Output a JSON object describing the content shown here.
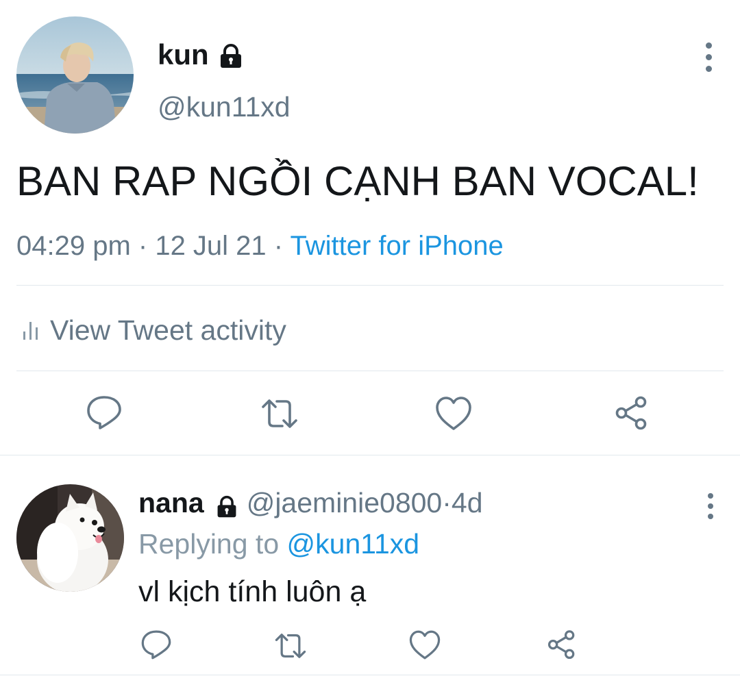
{
  "tweet": {
    "author_name": "kun",
    "author_handle": "@kun11xd",
    "protected": true,
    "text": "BAN RAP NGỒI CẠNH BAN VOCAL!",
    "time": "04:29 pm",
    "separator": " · ",
    "date": "12 Jul 21",
    "source": "Twitter for iPhone",
    "activity_label": "View Tweet activity",
    "actions": {
      "reply": "reply-icon",
      "retweet": "retweet-icon",
      "like": "heart-icon",
      "share": "share-icon"
    }
  },
  "reply": {
    "author_name": "nana",
    "author_handle": "@jaeminie0800",
    "separator": " · ",
    "age": "4d",
    "protected": true,
    "replying_prefix": "Replying to ",
    "replying_to": "@kun11xd",
    "text": "vl kịch tính luôn ạ"
  },
  "colors": {
    "text_primary": "#14171a",
    "text_secondary": "#657786",
    "link": "#1b95e0",
    "divider": "#e1e8ed"
  }
}
